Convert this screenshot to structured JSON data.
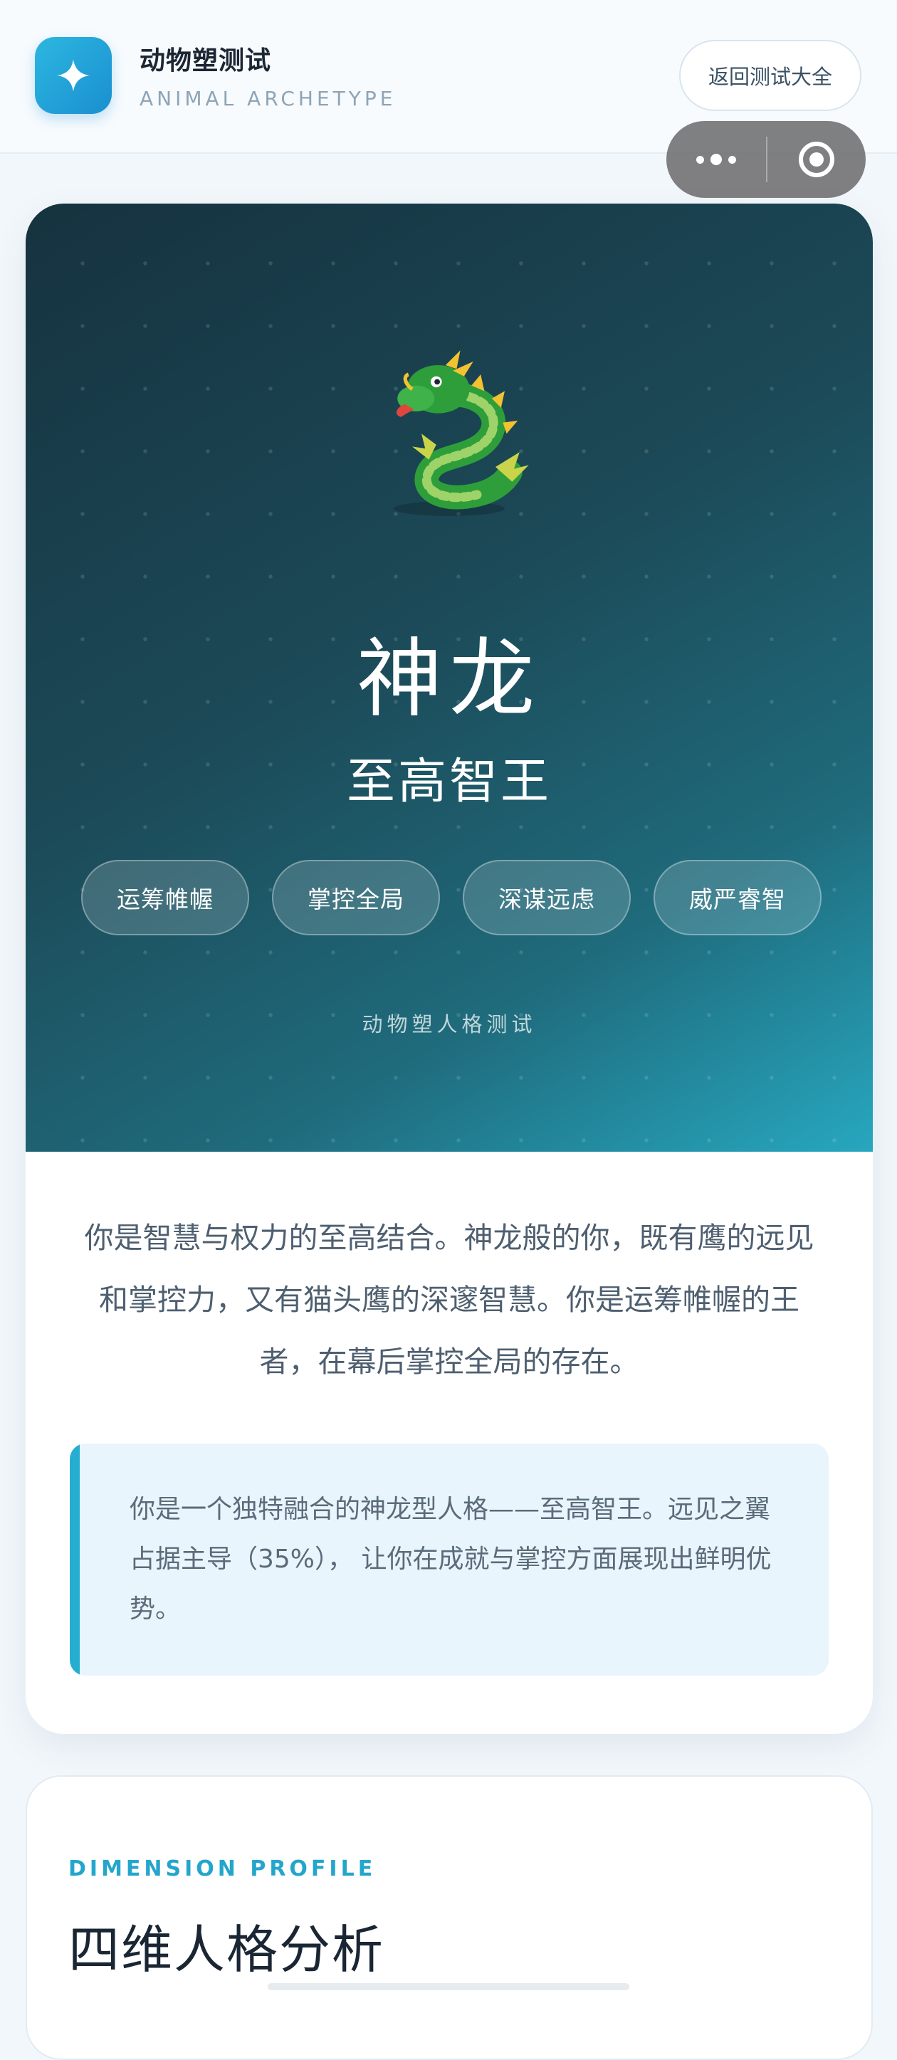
{
  "header": {
    "app_title": "动物塑测试",
    "app_subtitle": "ANIMAL ARCHETYPE",
    "back_label": "返回测试大全"
  },
  "result": {
    "emoji": "dragon-emoji",
    "name": "神龙",
    "title": "至高智王",
    "tags": [
      "运筹帷幄",
      "掌控全局",
      "深谋远虑",
      "威严睿智"
    ],
    "footer": "动物塑人格测试",
    "summary": "你是智慧与权力的至高结合。神龙般的你，既有鹰的远见和掌控力，又有猫头鹰的深邃智慧。你是运筹帷幄的王者，在幕后掌控全局的存在。",
    "quote": "你是一个独特融合的神龙型人格——至高智王。远见之翼占据主导（35%）， 让你在成就与掌控方面展现出鲜明优势。"
  },
  "dimension": {
    "eyebrow": "DIMENSION PROFILE",
    "title": "四维人格分析"
  },
  "colors": {
    "accent": "#25aed0",
    "hero_dark": "#16323f",
    "hero_light": "#27a7bf"
  },
  "icons": {
    "logo": "sparkle-icon",
    "capsule_more": "more-dots-icon",
    "capsule_close": "target-icon"
  }
}
